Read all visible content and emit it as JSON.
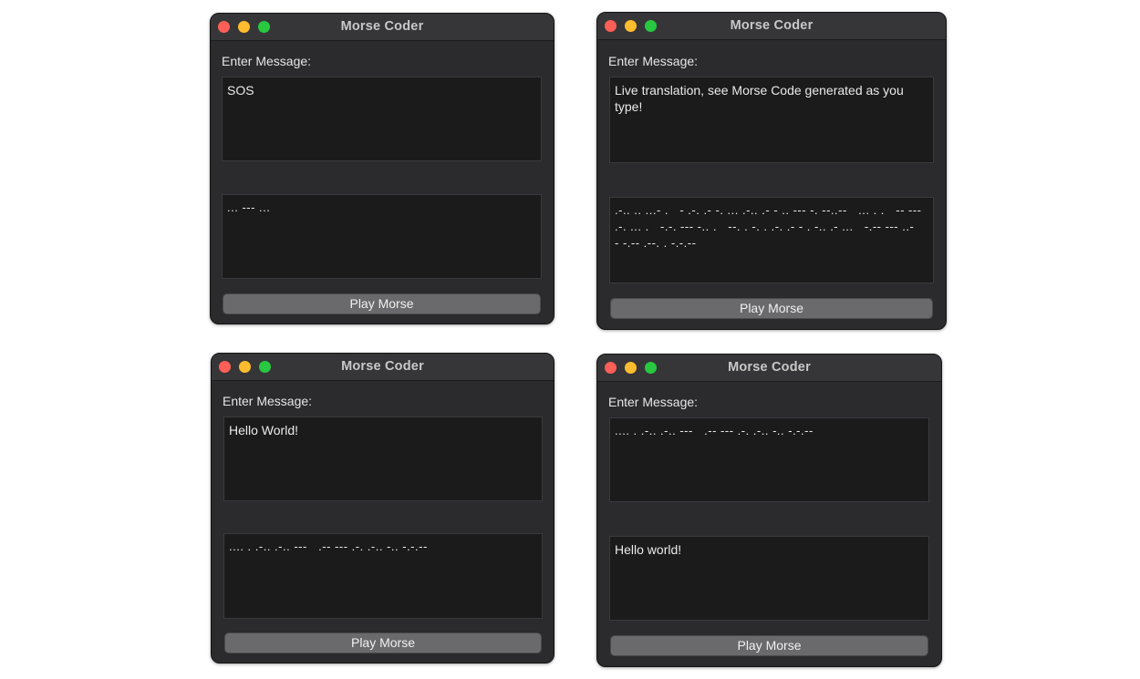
{
  "windows": [
    {
      "title": "Morse Coder",
      "input_label": "Enter Message:",
      "input_text": "SOS",
      "output_text": "... --- ...",
      "button_label": "Play Morse"
    },
    {
      "title": "Morse Coder",
      "input_label": "Enter Message:",
      "input_text": "Live translation, see Morse Code generated as you type!",
      "output_text": ".-.. .. ...- .   - .-. .- -. ... .-.. .- - .. --- -. --..--   ... . .   -- --- .-. ... .   -.-. --- -.. .   --. . -. . .-. .- - . -.. .- ...   -.-- --- ..-   - -.-- .--. . -.-.--",
      "button_label": "Play Morse"
    },
    {
      "title": "Morse Coder",
      "input_label": "Enter Message:",
      "input_text": "Hello World!",
      "output_text": ".... . .-.. .-.. ---   .-- --- .-. .-.. -.. -.-.--",
      "button_label": "Play Morse"
    },
    {
      "title": "Morse Coder",
      "input_label": "Enter Message:",
      "input_text": ".... . .-.. .-.. ---   .-- --- .-. .-.. -.. -.-.--",
      "output_text": "Hello world!",
      "button_label": "Play Morse"
    }
  ],
  "colors": {
    "window_bg": "#2b2b2d",
    "text_box_bg": "#1b1b1c",
    "button_bg": "#6a6a6c",
    "close": "#fe5f57",
    "minimize": "#febc2e",
    "zoom": "#28c840"
  }
}
